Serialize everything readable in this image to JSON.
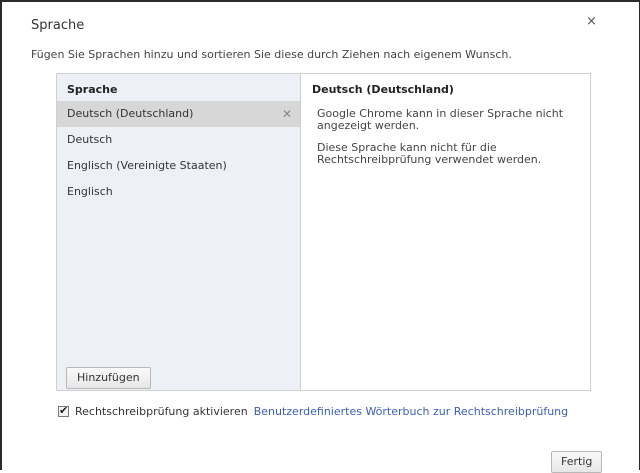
{
  "dialog": {
    "title": "Sprache",
    "close_icon": "close-icon",
    "description": "Fügen Sie Sprachen hinzu und sortieren Sie diese durch Ziehen nach eigenem Wunsch."
  },
  "languages": {
    "header": "Sprache",
    "items": [
      {
        "label": "Deutsch (Deutschland)",
        "selected": true
      },
      {
        "label": "Deutsch",
        "selected": false
      },
      {
        "label": "Englisch (Vereinigte Staaten)",
        "selected": false
      },
      {
        "label": "Englisch",
        "selected": false
      }
    ],
    "add_button": "Hinzufügen"
  },
  "details": {
    "header": "Deutsch (Deutschland)",
    "line1": "Google Chrome kann in dieser Sprache nicht angezeigt werden.",
    "line2": "Diese Sprache kann nicht für die Rechtschreibprüfung verwendet werden."
  },
  "spellcheck": {
    "checked": true,
    "label": "Rechtschreibprüfung aktivieren",
    "dictionary_link": "Benutzerdefiniertes Wörterbuch zur Rechtschreibprüfung"
  },
  "footer": {
    "done_button": "Fertig"
  }
}
